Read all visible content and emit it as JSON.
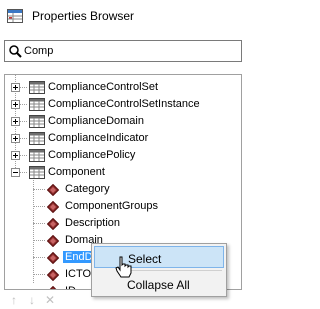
{
  "window": {
    "title": "Properties Browser",
    "icon": "properties-browser-icon"
  },
  "search": {
    "value": "Comp",
    "icon": "search-icon"
  },
  "tree": {
    "nodes": [
      {
        "label": "ComplianceControlSet",
        "expander": "plus"
      },
      {
        "label": "ComplianceControlSetInstance",
        "expander": "plus"
      },
      {
        "label": "ComplianceDomain",
        "expander": "plus"
      },
      {
        "label": "ComplianceIndicator",
        "expander": "plus"
      },
      {
        "label": "CompliancePolicy",
        "expander": "plus"
      },
      {
        "label": "Component",
        "expander": "minus",
        "expanded": true
      }
    ],
    "children": [
      {
        "label": "Category"
      },
      {
        "label": "ComponentGroups"
      },
      {
        "label": "Description"
      },
      {
        "label": "Domain"
      },
      {
        "label": "EndD",
        "selected": true
      },
      {
        "label": "ICTO"
      },
      {
        "label": "ID"
      }
    ]
  },
  "context_menu": {
    "items": [
      {
        "label": "Select",
        "highlighted": true
      },
      {
        "label": "Collapse All"
      }
    ]
  },
  "toolbar": {
    "buttons": [
      "up-arrow-icon",
      "down-arrow-icon",
      "close-icon"
    ]
  },
  "colors": {
    "selection": "#3399ff",
    "menu_highlight": "#cce4f7",
    "menu_bg": "#f2f2f2"
  }
}
